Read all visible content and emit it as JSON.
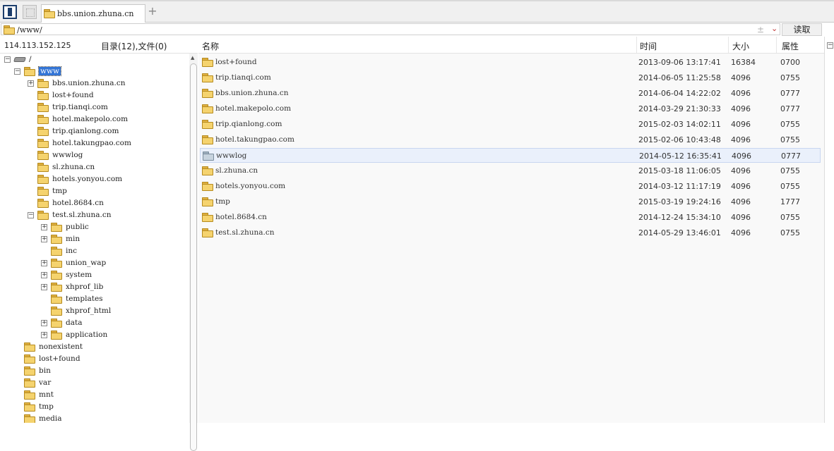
{
  "tab": {
    "title": "bbs.union.zhuna.cn",
    "add_label": "+"
  },
  "address": {
    "path": "/www/",
    "pm_symbol": "±",
    "read_button": "读取"
  },
  "left_header": {
    "ip": "114.113.152.125",
    "summary": "目录(12),文件(0)"
  },
  "columns": {
    "name": "名称",
    "time": "时间",
    "size": "大小",
    "attr": "属性"
  },
  "tree": [
    {
      "label": "/",
      "icon": "drive-icon",
      "expander": "−"
    },
    {
      "label": "www",
      "icon": "folder-open-icon",
      "expander": "−",
      "selected": true
    },
    {
      "label": "bbs.union.zhuna.cn",
      "icon": "folder-icon",
      "expander": "+"
    },
    {
      "label": "lost+found",
      "icon": "folder-icon"
    },
    {
      "label": "trip.tianqi.com",
      "icon": "folder-icon"
    },
    {
      "label": "hotel.makepolo.com",
      "icon": "folder-icon"
    },
    {
      "label": "trip.qianlong.com",
      "icon": "folder-icon"
    },
    {
      "label": "hotel.takungpao.com",
      "icon": "folder-icon"
    },
    {
      "label": "wwwlog",
      "icon": "folder-icon"
    },
    {
      "label": "sl.zhuna.cn",
      "icon": "folder-icon"
    },
    {
      "label": "hotels.yonyou.com",
      "icon": "folder-icon"
    },
    {
      "label": "tmp",
      "icon": "folder-icon"
    },
    {
      "label": "hotel.8684.cn",
      "icon": "folder-icon"
    },
    {
      "label": "test.sl.zhuna.cn",
      "icon": "folder-icon",
      "expander": "−"
    },
    {
      "label": "public",
      "icon": "folder-icon",
      "expander": "+"
    },
    {
      "label": "min",
      "icon": "folder-icon",
      "expander": "+"
    },
    {
      "label": "inc",
      "icon": "folder-icon"
    },
    {
      "label": "union_wap",
      "icon": "folder-icon",
      "expander": "+"
    },
    {
      "label": "system",
      "icon": "folder-icon",
      "expander": "+"
    },
    {
      "label": "xhprof_lib",
      "icon": "folder-icon",
      "expander": "+"
    },
    {
      "label": "templates",
      "icon": "folder-icon"
    },
    {
      "label": "xhprof_html",
      "icon": "folder-icon"
    },
    {
      "label": "data",
      "icon": "folder-icon",
      "expander": "+"
    },
    {
      "label": "application",
      "icon": "folder-icon",
      "expander": "+"
    },
    {
      "label": "nonexistent",
      "icon": "folder-icon"
    },
    {
      "label": "lost+found",
      "icon": "folder-icon"
    },
    {
      "label": "bin",
      "icon": "folder-icon"
    },
    {
      "label": "var",
      "icon": "folder-icon"
    },
    {
      "label": "mnt",
      "icon": "folder-icon"
    },
    {
      "label": "tmp",
      "icon": "folder-icon"
    },
    {
      "label": "media",
      "icon": "folder-icon"
    }
  ],
  "files": [
    {
      "name": "lost+found",
      "time": "2013-09-06 13:17:41",
      "size": "16384",
      "attr": "0700"
    },
    {
      "name": "trip.tianqi.com",
      "time": "2014-06-05 11:25:58",
      "size": "4096",
      "attr": "0755"
    },
    {
      "name": "bbs.union.zhuna.cn",
      "time": "2014-06-04 14:22:02",
      "size": "4096",
      "attr": "0777"
    },
    {
      "name": "hotel.makepolo.com",
      "time": "2014-03-29 21:30:33",
      "size": "4096",
      "attr": "0777"
    },
    {
      "name": "trip.qianlong.com",
      "time": "2015-02-03 14:02:11",
      "size": "4096",
      "attr": "0755"
    },
    {
      "name": "hotel.takungpao.com",
      "time": "2015-02-06 10:43:48",
      "size": "4096",
      "attr": "0755"
    },
    {
      "name": "wwwlog",
      "time": "2014-05-12 16:35:41",
      "size": "4096",
      "attr": "0777",
      "selected": true
    },
    {
      "name": "sl.zhuna.cn",
      "time": "2015-03-18 11:06:05",
      "size": "4096",
      "attr": "0755"
    },
    {
      "name": "hotels.yonyou.com",
      "time": "2014-03-12 11:17:19",
      "size": "4096",
      "attr": "0755"
    },
    {
      "name": "tmp",
      "time": "2015-03-19 19:24:16",
      "size": "4096",
      "attr": "1777"
    },
    {
      "name": "hotel.8684.cn",
      "time": "2014-12-24 15:34:10",
      "size": "4096",
      "attr": "0755"
    },
    {
      "name": "test.sl.zhuna.cn",
      "time": "2014-05-29 13:46:01",
      "size": "4096",
      "attr": "0755"
    }
  ],
  "colors": {
    "folder": "#f5d36e",
    "selection": "#3375d6",
    "row_selected": "#eaf0fb"
  }
}
